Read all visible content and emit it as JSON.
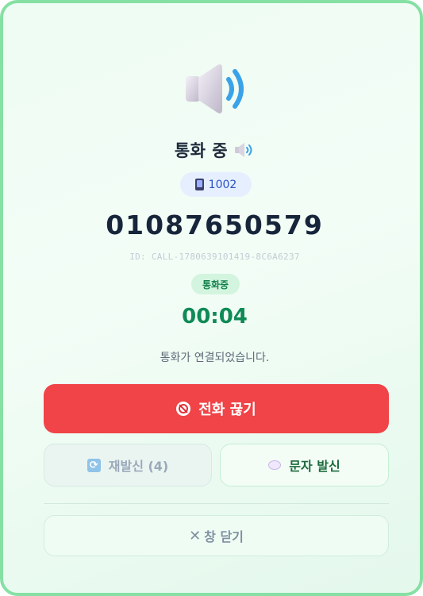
{
  "call": {
    "title": "통화 중",
    "extension": "1002",
    "phone_number": "01087650579",
    "call_id": "ID: CALL-1780639101419-8C6A6237",
    "status_badge": "통화중",
    "timer": "00:04",
    "message": "통화가 연결되었습니다."
  },
  "buttons": {
    "hangup_label": "전화 끊기",
    "redial_label": "재발신 (4)",
    "sms_label": "문자 발신",
    "close_label": "창 닫기"
  },
  "icons": {
    "speaker_large": "speaker-icon",
    "speaker_small": "speaker-icon",
    "extension": "mobile-phone-icon",
    "hangup": "no-phone-icon",
    "redial": "repeat-icon",
    "sms": "speech-bubble-icon",
    "close": "close-icon"
  },
  "colors": {
    "accent_green": "#0f8a56",
    "hangup_red": "#f04448",
    "border_green": "#86e0a4",
    "extension_blue": "#2952c4"
  }
}
